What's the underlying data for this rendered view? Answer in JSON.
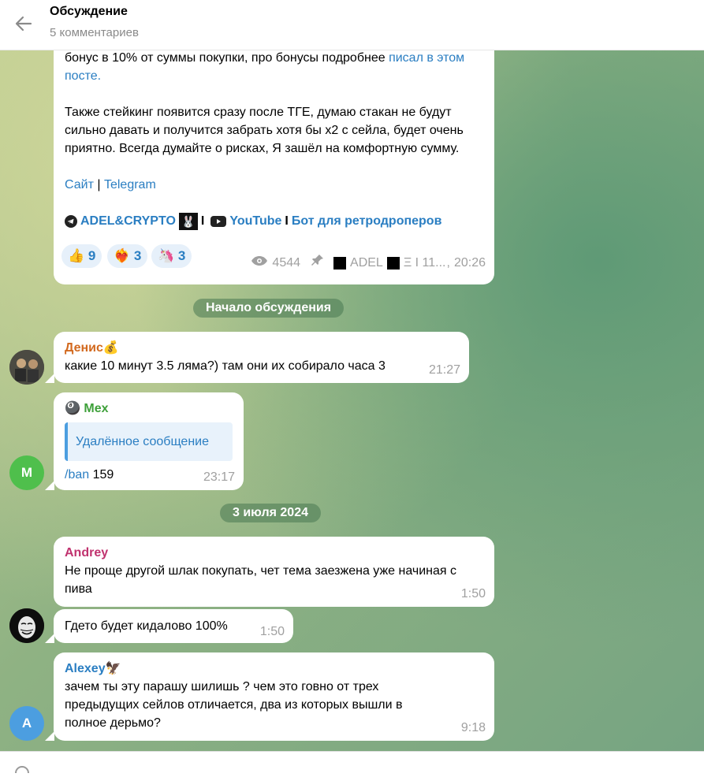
{
  "header": {
    "title": "Обсуждение",
    "subtitle": "5 комментариев"
  },
  "post": {
    "text1": "бонус в 10% от суммы покупки, про бонусы подробнее ",
    "link1": "писал в этом посте.",
    "text2": "Также стейкинг появится сразу после ТГЕ, думаю стакан не будут сильно давать и получится забрать хотя бы x2 с сейла, будет очень приятно. Всегда думайте о рисках, Я зашёл на комфортную сумму.",
    "site": "Сайт",
    "sep": "|",
    "telegram": "Telegram",
    "channel": "ADEL&CRYPTO",
    "sep2": "I",
    "youtube": "YouTube",
    "sep3": "I",
    "bot": "Бот для ретродроперов",
    "reactions": [
      {
        "emoji": "👍",
        "count": "9"
      },
      {
        "emoji": "❤️‍🔥",
        "count": "3"
      },
      {
        "emoji": "🦄",
        "count": "3"
      }
    ],
    "views": "4544",
    "signature": "ADEL",
    "signature_tail": "Ξ I 11...",
    "time": "20:26"
  },
  "service_discussion": "Начало обсуждения",
  "service_date": "3 июля 2024",
  "messages": [
    {
      "name": "Денис",
      "text": "какие 10 минут 3.5 ляма?) там они их собирало часа 3",
      "time": "21:27",
      "name_color": "#d2691e"
    },
    {
      "name": "Mex",
      "reply": "Удалённое сообщение",
      "cmd": "/ban",
      "text": "159",
      "time": "23:17",
      "avatar": "M",
      "name_color": "#3ea03a"
    },
    {
      "name": "Andrey",
      "text": "Не проще другой шлак покупать, чет тема заезжена уже начиная с пива",
      "time": "1:50",
      "name_color": "#c0326e"
    },
    {
      "text": "Гдето будет кидалово 100%",
      "time": "1:50"
    },
    {
      "name": "Alexey",
      "text": "зачем ты эту парашу шилишь ? чем это говно от трех предыдущих сейлов отличается, два из которых вышли в полное дерьмо?",
      "time": "9:18",
      "avatar": "A",
      "name_color": "#2a7ec2"
    }
  ],
  "colors": {
    "accent": "#2a7ec2",
    "avatar_m": "#4fbf4c",
    "avatar_a": "#4c9ee0"
  }
}
